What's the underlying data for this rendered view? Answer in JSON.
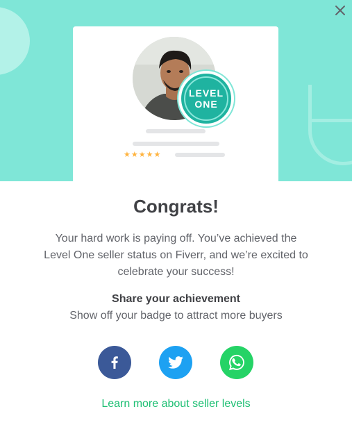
{
  "hero": {
    "colors": {
      "background": "#7fe6d7",
      "badge": "#1fb3a0",
      "stars": "#ffb33e"
    },
    "badge": {
      "line1": "LEVEL",
      "line2": "ONE"
    },
    "rating_stars": "★★★★★",
    "close_icon": "close-icon"
  },
  "content": {
    "title": "Congrats!",
    "message": "Your hard work is paying off. You’ve achieved the Level One seller status on Fiverr, and we’re excited to celebrate your success!",
    "share_heading": "Share your achievement",
    "share_subtitle": "Show off your badge to attract more buyers"
  },
  "share_buttons": [
    {
      "network": "facebook",
      "icon": "facebook-icon",
      "color": "#3b5998"
    },
    {
      "network": "twitter",
      "icon": "twitter-icon",
      "color": "#1da1f2"
    },
    {
      "network": "whatsapp",
      "icon": "whatsapp-icon",
      "color": "#25d366"
    }
  ],
  "footer": {
    "learn_more_link": "Learn more about seller levels",
    "link_color": "#1dbf73"
  }
}
